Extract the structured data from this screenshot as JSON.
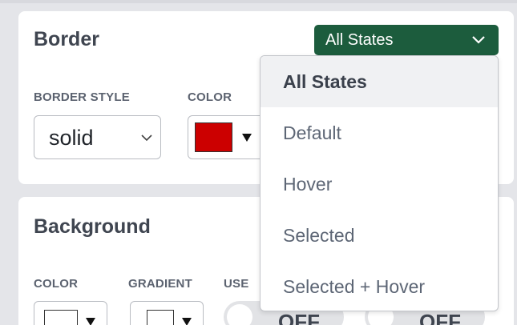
{
  "border_panel": {
    "title": "Border",
    "border_style_label": "BORDER STYLE",
    "border_style_value": "solid",
    "color_label": "COLOR",
    "color_value": "#cc0000"
  },
  "background_panel": {
    "title": "Background",
    "color_label": "COLOR",
    "gradient_label": "GRADIENT",
    "use_label": "USE",
    "toggle_1": "OFF",
    "toggle_2": "OFF"
  },
  "state_selector": {
    "selected": "All States",
    "options": [
      "All States",
      "Default",
      "Hover",
      "Selected",
      "Selected + Hover"
    ]
  },
  "colors": {
    "accent": "#1c5c3d",
    "swatch_red": "#cc0000"
  }
}
